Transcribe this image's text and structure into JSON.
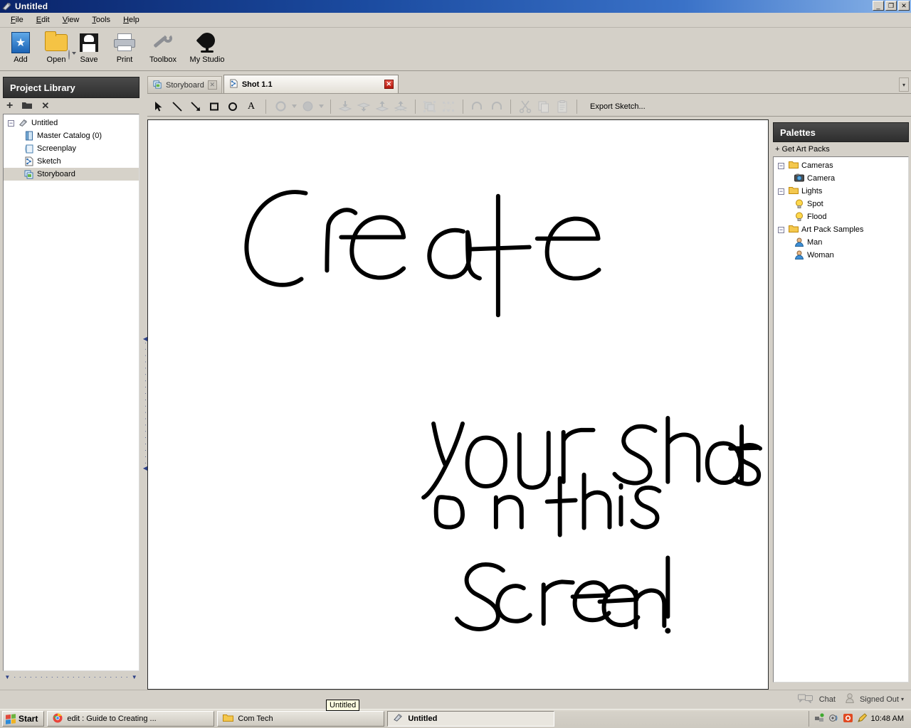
{
  "window": {
    "title": "Untitled",
    "icon": "app-icon",
    "buttons": {
      "minimize": "_",
      "restore": "❐",
      "close": "✕"
    }
  },
  "menubar": {
    "items": [
      {
        "label": "File",
        "accel": "F"
      },
      {
        "label": "Edit",
        "accel": "E"
      },
      {
        "label": "View",
        "accel": "V"
      },
      {
        "label": "Tools",
        "accel": "T"
      },
      {
        "label": "Help",
        "accel": "H"
      }
    ]
  },
  "toolbar": {
    "buttons": [
      {
        "label": "Add",
        "icon": "add-star-icon"
      },
      {
        "label": "Open",
        "icon": "folder-open-icon"
      },
      {
        "label": "Save",
        "icon": "floppy-disk-icon"
      },
      {
        "label": "Print",
        "icon": "printer-icon"
      },
      {
        "label": "Toolbox",
        "icon": "wrench-icon"
      },
      {
        "label": "My Studio",
        "icon": "spade-tree-icon"
      }
    ],
    "open_dropdown": "open-dropdown-arrow"
  },
  "project_library": {
    "title": "Project Library",
    "tools": [
      {
        "name": "add-item-button",
        "glyph": "+"
      },
      {
        "name": "new-folder-button",
        "glyph": "▬"
      },
      {
        "name": "delete-item-button",
        "glyph": "✕"
      }
    ],
    "tree": [
      {
        "label": "Untitled",
        "icon": "project-icon",
        "indent": 0,
        "expander": "−",
        "selected": false
      },
      {
        "label": "Master Catalog (0)",
        "icon": "catalog-icon",
        "indent": 1,
        "selected": false
      },
      {
        "label": "Screenplay",
        "icon": "screenplay-icon",
        "indent": 1,
        "selected": false
      },
      {
        "label": "Sketch",
        "icon": "sketch-icon",
        "indent": 1,
        "selected": false
      },
      {
        "label": "Storyboard",
        "icon": "storyboard-icon",
        "indent": 1,
        "selected": true
      }
    ]
  },
  "tabs": {
    "items": [
      {
        "label": "Storyboard",
        "icon": "storyboard-icon",
        "active": false,
        "close": "✕"
      },
      {
        "label": "Shot 1.1",
        "icon": "sketch-icon",
        "active": true,
        "close": "✕"
      }
    ],
    "overflow_button": "▾"
  },
  "sketch_toolbar": {
    "tools": [
      {
        "name": "select-tool",
        "glyph": "arrow-cursor-icon",
        "enabled": true
      },
      {
        "name": "line-tool",
        "glyph": "line-icon",
        "enabled": true
      },
      {
        "name": "arrow-tool",
        "glyph": "arrow-icon",
        "enabled": true
      },
      {
        "name": "rectangle-tool",
        "glyph": "square-icon",
        "enabled": true
      },
      {
        "name": "ellipse-tool",
        "glyph": "circle-icon",
        "enabled": true
      },
      {
        "name": "text-tool",
        "glyph": "text-A-icon",
        "enabled": true
      },
      {
        "name": "stroke-color",
        "glyph": "stroke-ring-icon",
        "enabled": false
      },
      {
        "name": "fill-color",
        "glyph": "fill-circle-icon",
        "enabled": false
      },
      {
        "name": "send-to-back",
        "glyph": "send-to-back-icon",
        "enabled": false
      },
      {
        "name": "send-backward",
        "glyph": "send-backward-icon",
        "enabled": false
      },
      {
        "name": "bring-forward",
        "glyph": "bring-forward-icon",
        "enabled": false
      },
      {
        "name": "bring-to-front",
        "glyph": "bring-to-front-icon",
        "enabled": false
      },
      {
        "name": "group",
        "glyph": "group-icon",
        "enabled": false
      },
      {
        "name": "ungroup",
        "glyph": "ungroup-icon",
        "enabled": false
      },
      {
        "name": "undo",
        "glyph": "undo-icon",
        "enabled": false
      },
      {
        "name": "redo",
        "glyph": "redo-icon",
        "enabled": false
      },
      {
        "name": "cut",
        "glyph": "scissors-icon",
        "enabled": false
      },
      {
        "name": "copy",
        "glyph": "copy-icon",
        "enabled": false
      },
      {
        "name": "paste",
        "glyph": "clipboard-icon",
        "enabled": false
      }
    ],
    "export_label": "Export Sketch..."
  },
  "canvas": {
    "handwriting_text": "Create your shots on this Screen!",
    "ink_color": "#000000",
    "background": "#ffffff"
  },
  "palettes": {
    "title": "Palettes",
    "get_art_packs": "+ Get Art Packs",
    "tree": [
      {
        "label": "Cameras",
        "icon": "folder-icon",
        "indent": 0,
        "expander": "−"
      },
      {
        "label": "Camera",
        "icon": "camera-icon",
        "indent": 1
      },
      {
        "label": "Lights",
        "icon": "folder-icon",
        "indent": 0,
        "expander": "−"
      },
      {
        "label": "Spot",
        "icon": "bulb-icon",
        "indent": 1
      },
      {
        "label": "Flood",
        "icon": "bulb-icon",
        "indent": 1
      },
      {
        "label": "Art Pack Samples",
        "icon": "folder-icon",
        "indent": 0,
        "expander": "−"
      },
      {
        "label": "Man",
        "icon": "person-icon",
        "indent": 1
      },
      {
        "label": "Woman",
        "icon": "person-icon",
        "indent": 1
      }
    ]
  },
  "statusbar": {
    "chat_label": "Chat",
    "chat_icon": "chat-bubbles-icon",
    "account_icon": "user-icon",
    "account_label": "Signed Out",
    "account_caret": "▾"
  },
  "tooltip": {
    "text": "Untitled"
  },
  "taskbar": {
    "start_label": "Start",
    "items": [
      {
        "label": "edit : Guide to Creating ...",
        "icon": "chrome-icon",
        "active": false
      },
      {
        "label": "Com Tech",
        "icon": "folder-icon",
        "active": false
      },
      {
        "label": "Untitled",
        "icon": "app-icon",
        "active": true
      }
    ],
    "tray_icons": [
      "network-icon",
      "volume-icon",
      "shield-icon",
      "pencil-icon"
    ],
    "clock": "10:48 AM"
  },
  "colors": {
    "window_chrome": "#d4d0c8",
    "titlebar_start": "#0a246a",
    "titlebar_end": "#8ab4e8",
    "panel_header": "#333333",
    "selection": "#d6d2c9",
    "accent_red": "#c01a0e"
  }
}
